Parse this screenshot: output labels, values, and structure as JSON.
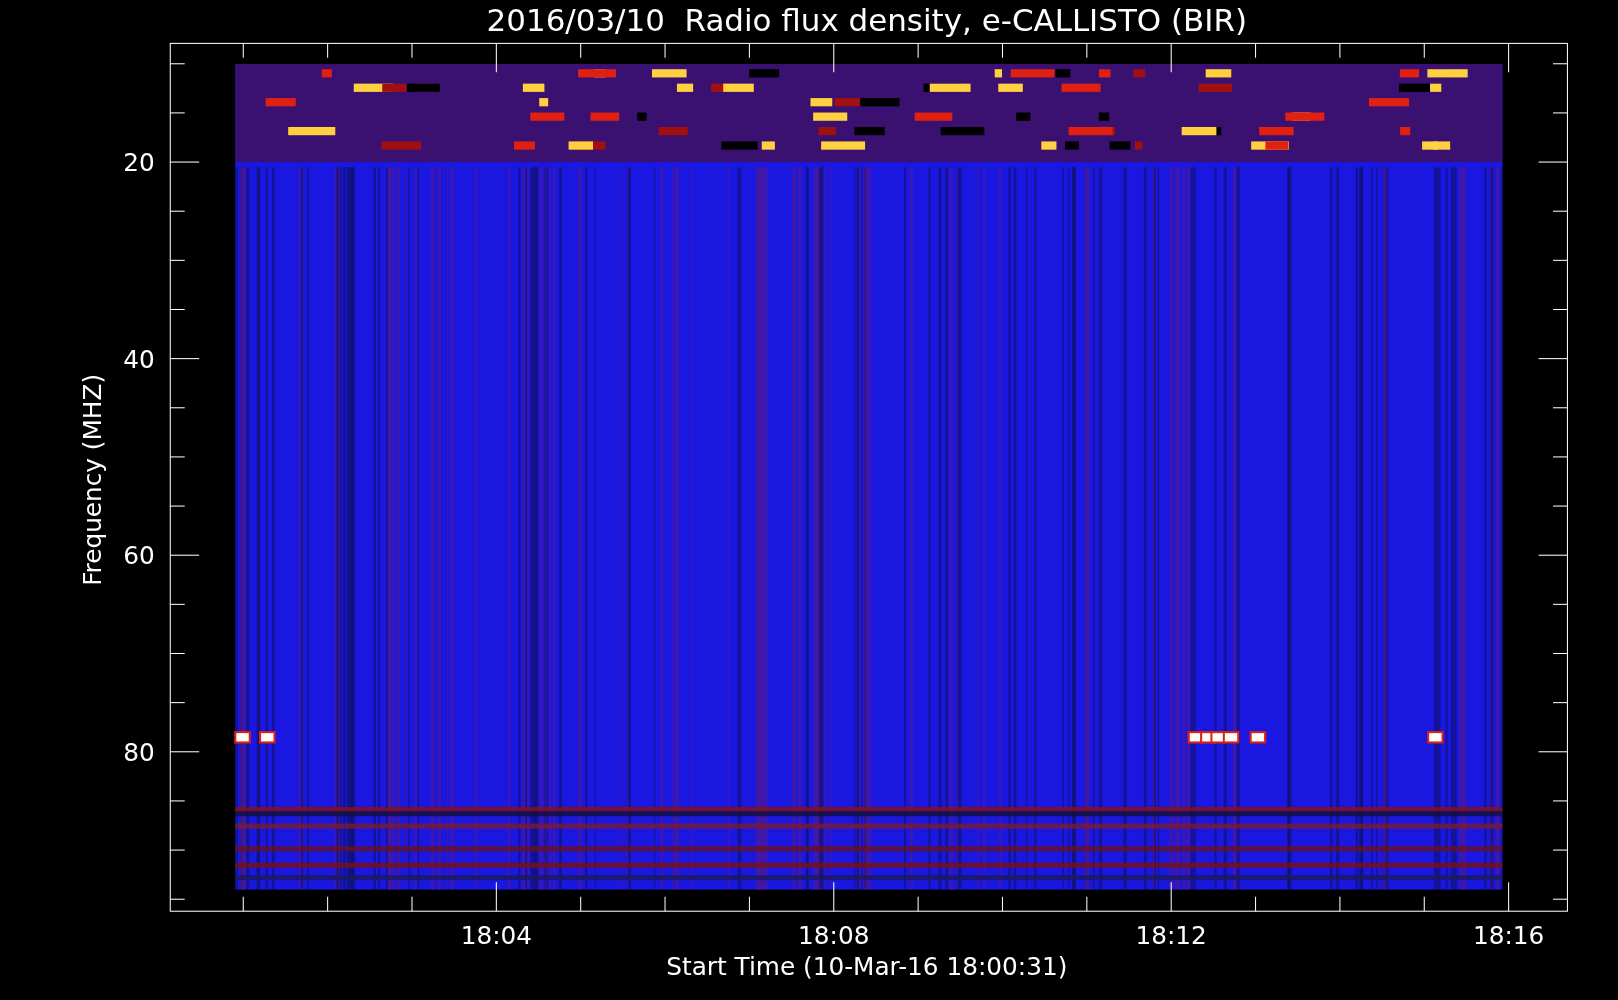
{
  "plot": {
    "title": "2016/03/10  Radio flux density, e-CALLISTO (BIR)",
    "ylabel": "Frequency (MHZ)",
    "xlabel": "Start Time (10-Mar-16 18:00:31)",
    "y_tick_labels": [
      "20",
      "40",
      "60",
      "80"
    ],
    "x_tick_labels": [
      "18:04",
      "18:08",
      "18:12",
      "18:16"
    ]
  }
}
